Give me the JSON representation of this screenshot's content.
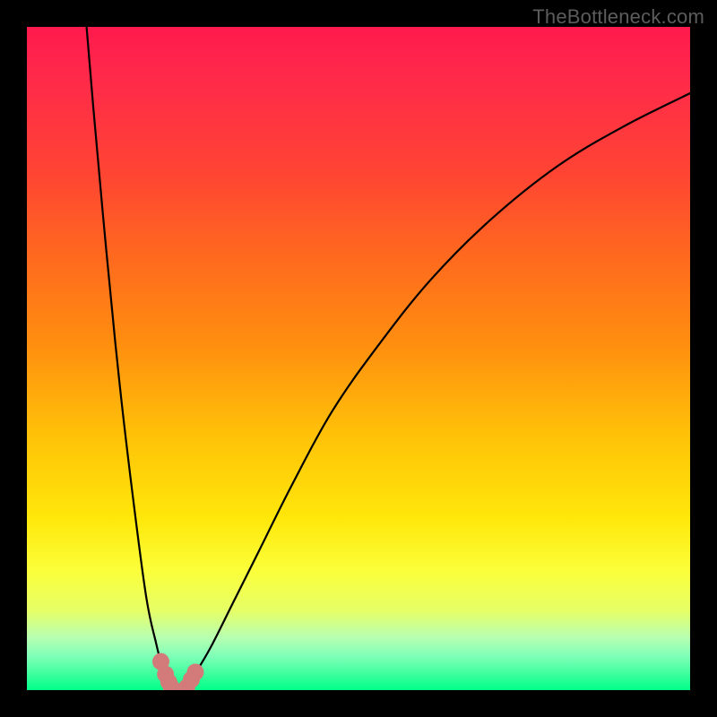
{
  "watermark": "TheBottleneck.com",
  "chart_data": {
    "type": "line",
    "title": "",
    "xlabel": "",
    "ylabel": "",
    "xlim": [
      0,
      100
    ],
    "ylim": [
      0,
      100
    ],
    "series": [
      {
        "name": "left-curve",
        "x": [
          9,
          10,
          12,
          14,
          16,
          18,
          19.5,
          20.2,
          20.9,
          21.4,
          21.8
        ],
        "y": [
          100,
          88,
          66,
          46,
          29,
          14,
          7,
          4.3,
          2.4,
          1.2,
          0.4
        ]
      },
      {
        "name": "right-curve",
        "x": [
          24.1,
          24.8,
          26,
          28,
          31,
          35,
          40,
          46,
          53,
          61,
          70,
          80,
          90,
          100
        ],
        "y": [
          0.4,
          1.6,
          3.5,
          7,
          13,
          21,
          31,
          42,
          52,
          62,
          71,
          79,
          85,
          90
        ]
      }
    ],
    "marks": [
      {
        "name": "left-cluster",
        "points": [
          {
            "x": 20.2,
            "y": 4.3
          },
          {
            "x": 20.9,
            "y": 2.4
          },
          {
            "x": 21.4,
            "y": 1.2
          },
          {
            "x": 21.8,
            "y": 0.4
          }
        ]
      },
      {
        "name": "right-cluster",
        "points": [
          {
            "x": 24.1,
            "y": 0.4
          },
          {
            "x": 24.8,
            "y": 1.6
          },
          {
            "x": 25.4,
            "y": 2.7
          }
        ]
      }
    ]
  }
}
